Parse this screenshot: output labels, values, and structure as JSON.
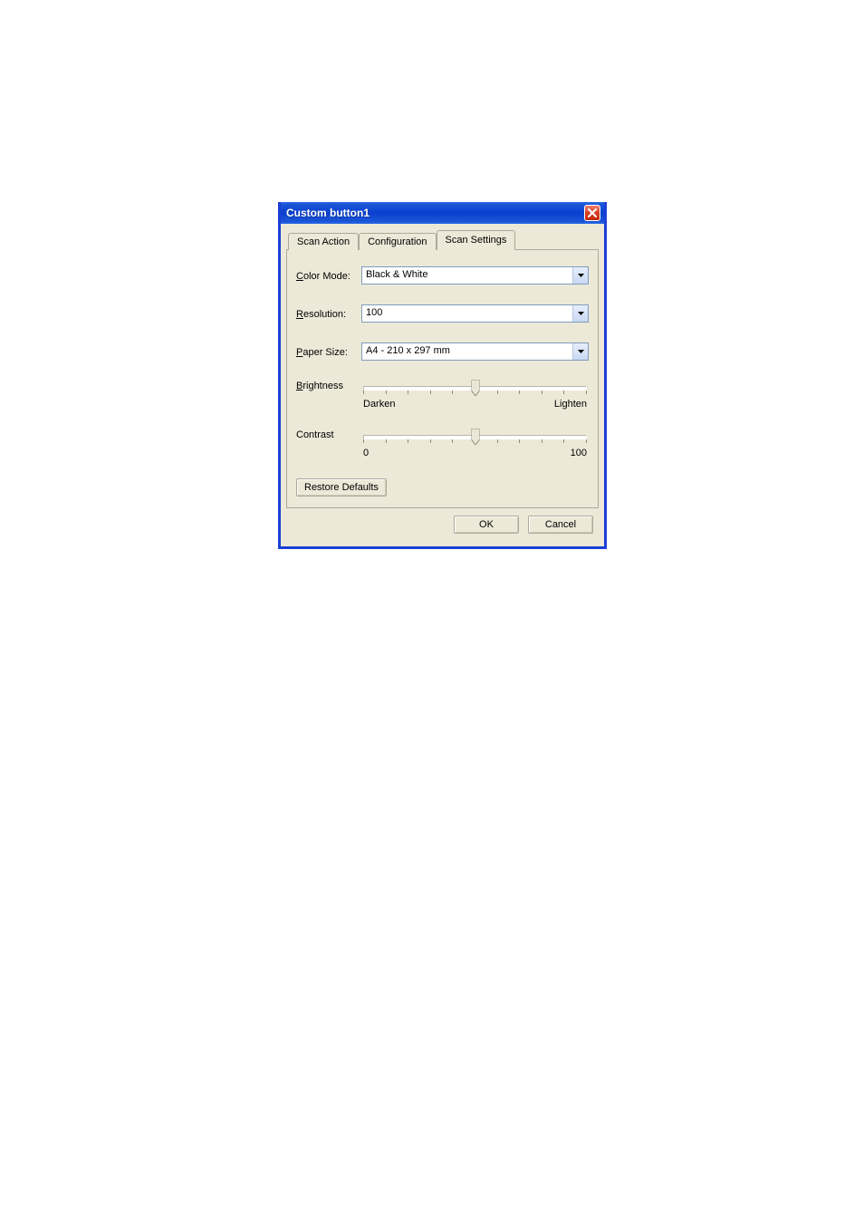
{
  "title": "Custom button1",
  "tabs": [
    "Scan Action",
    "Configuration",
    "Scan Settings"
  ],
  "active_tab_index": 2,
  "fields": {
    "color_mode": {
      "label": "Color Mode:",
      "value": "Black & White"
    },
    "resolution": {
      "label": "Resolution:",
      "value": "100"
    },
    "paper_size": {
      "label": "Paper Size:",
      "value": "A4 - 210 x 297 mm"
    },
    "brightness": {
      "label": "Brightness",
      "left_label": "Darken",
      "right_label": "Lighten",
      "value_percent": 50,
      "ticks": 11
    },
    "contrast": {
      "label": "Contrast",
      "left_label": "0",
      "right_label": "100",
      "value_percent": 50,
      "ticks": 11
    }
  },
  "buttons": {
    "restore_defaults": "Restore Defaults",
    "ok": "OK",
    "cancel": "Cancel"
  }
}
